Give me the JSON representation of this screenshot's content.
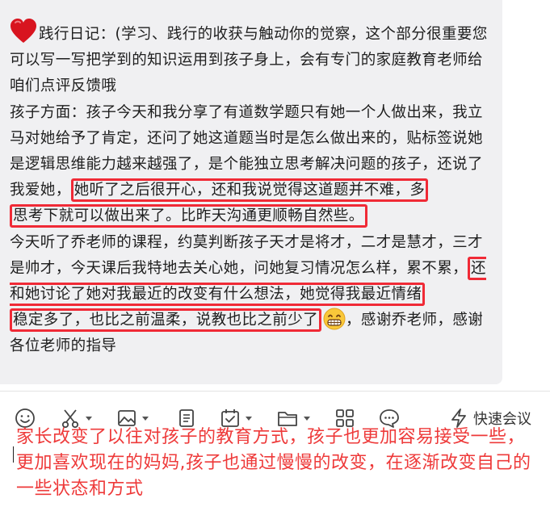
{
  "message": {
    "intro": "践行日记：(学习、践行的收获与触动你的觉察，这个部分很重要您可以写一写把学到的知识运用到孩子身上，会有专门的家庭教育老师给咱们点评反馈哦",
    "para2_plain": "孩子方面：孩子今天和我分享了有道数学题只有她一个人做出来，我立马对她给予了肯定，还问了她这道题当时是怎么做出来的，贴标签说她是逻辑思维能力越来越强了，是个能独立思考解决问题的孩子，还说了我爱她，",
    "para2_highlight_a": "她听了之后很开心，还和我说觉得这道题并不难，多",
    "para2_highlight_b": "思考下就可以做出来了。比昨天沟通更顺畅自然些。",
    "para3_plain": "今天听了乔老师的课程，约莫判断孩子天才是将才，二才是慧才，三才是帅才，今天课后我特地去关心她，问她复习情况怎么样，累不累，",
    "para3_highlight_a": "还和她讨论了她对我最近的改变有什么想法，她觉得我最近情绪",
    "para3_highlight_b": "稳定多了，也比之前温柔，说教也比之前少了",
    "para3_tail": "，感谢乔老师，感谢各位老师的指导",
    "heart_icon": "heart-icon",
    "grin_icon": "grinning-face-icon",
    "highlight_color": "#f02a36"
  },
  "toolbar": {
    "meeting_label": "快速会议",
    "icons": [
      "emoji-icon",
      "scissors-icon",
      "image-icon",
      "document-icon",
      "todo-icon",
      "folder-icon",
      "apps-icon",
      "chat-bubble-icon",
      "lightning-icon"
    ]
  },
  "composer": {
    "text": "家长改变了以往对孩子的教育方式，孩子也更加容易接受一些，更加喜欢现在的妈妈,孩子也通过慢慢的改变，在逐渐改变自己的一些状态和方式",
    "text_color": "#ee3a3a"
  }
}
